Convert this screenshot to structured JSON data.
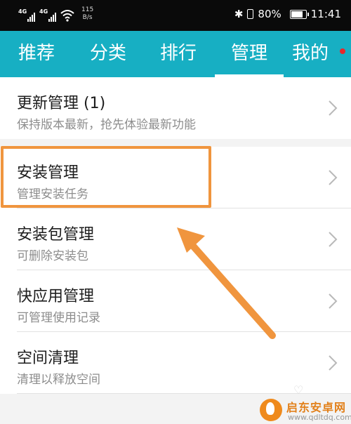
{
  "status_bar": {
    "sim1_label": "4G",
    "sim2_label": "4G",
    "net_speed_value": "115",
    "net_speed_unit": "B/s",
    "battery": "80%",
    "time": "11:41"
  },
  "tabs": [
    {
      "label": "推荐",
      "active": false
    },
    {
      "label": "分类",
      "active": false
    },
    {
      "label": "排行",
      "active": false
    },
    {
      "label": "管理",
      "active": true
    },
    {
      "label": "我的",
      "active": false,
      "badge": true
    }
  ],
  "list": {
    "update": {
      "title": "更新管理 (1)",
      "subtitle": "保持版本最新，抢先体验最新功能"
    },
    "items": [
      {
        "title": "安装管理",
        "subtitle": "管理安装任务"
      },
      {
        "title": "安装包管理",
        "subtitle": "可删除安装包"
      },
      {
        "title": "快应用管理",
        "subtitle": "可管理使用记录"
      },
      {
        "title": "空间清理",
        "subtitle": "清理以释放空间"
      }
    ]
  },
  "annotation": {
    "color": "#f0953e"
  },
  "watermark": {
    "name": "启东安卓网",
    "url": "www.qdltdq.com"
  },
  "colors": {
    "accent": "#17afc3",
    "badge": "#e8272b",
    "status_bar": "#0a0a0a"
  }
}
